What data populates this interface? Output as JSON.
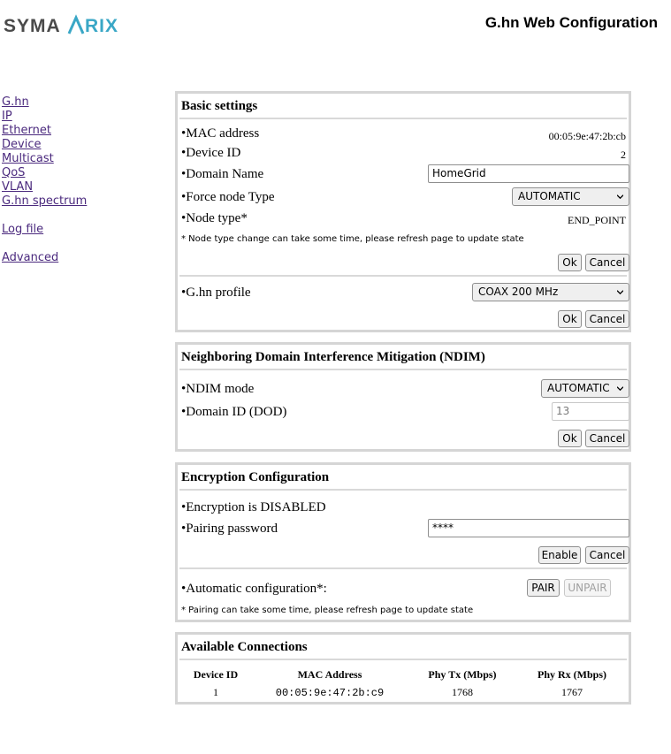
{
  "header": {
    "logo_text": "SYMARIX",
    "title": "G.hn Web Configuration"
  },
  "nav": {
    "items": [
      "G.hn",
      "IP",
      "Ethernet",
      "Device",
      "Multicast",
      "QoS",
      "VLAN",
      "G.hn spectrum"
    ],
    "log_file": "Log file",
    "advanced": "Advanced"
  },
  "basic": {
    "title": "Basic settings",
    "mac_label": "•MAC address",
    "mac_value": "00:05:9e:47:2b:cb",
    "device_id_label": "•Device ID",
    "device_id_value": "2",
    "domain_label": "•Domain Name",
    "domain_value": "HomeGrid",
    "force_label": "•Force node Type",
    "force_value": "AUTOMATIC",
    "node_type_label": "•Node type*",
    "node_type_value": "END_POINT",
    "note": "* Node type change can take some time, please refresh page to update state",
    "ok": "Ok",
    "cancel": "Cancel",
    "profile_label": "•G.hn profile",
    "profile_value": "COAX 200 MHz"
  },
  "ndim": {
    "title": "Neighboring Domain Interference Mitigation (NDIM)",
    "mode_label": "•NDIM mode",
    "mode_value": "AUTOMATIC",
    "domain_id_label": "•Domain ID (DOD)",
    "domain_id_value": "13",
    "ok": "Ok",
    "cancel": "Cancel"
  },
  "encryption": {
    "title": "Encryption Configuration",
    "status": "•Encryption is DISABLED",
    "password_label": "•Pairing password",
    "password_value": "****",
    "enable": "Enable",
    "cancel": "Cancel",
    "auto_label": "•Automatic configuration*:",
    "pair": "PAIR",
    "unpair": "UNPAIR",
    "note": "* Pairing can take some time, please refresh page to update state"
  },
  "connections": {
    "title": "Available Connections",
    "headers": [
      "Device ID",
      "MAC Address",
      "Phy Tx (Mbps)",
      "Phy Rx (Mbps)"
    ],
    "rows": [
      [
        "1",
        "00:05:9e:47:2b:c9",
        "1768",
        "1767"
      ]
    ]
  }
}
